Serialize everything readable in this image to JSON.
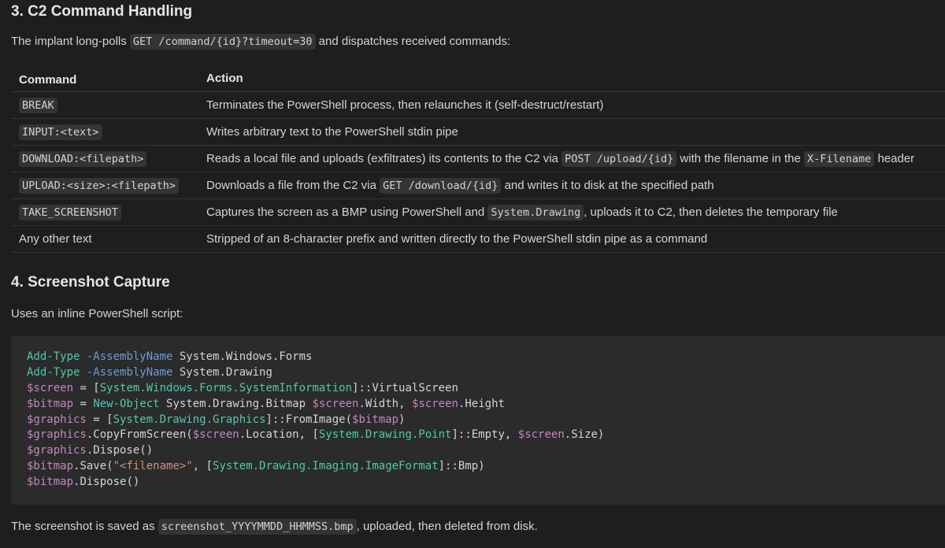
{
  "section3": {
    "heading": "3. C2 Command Handling",
    "intro_before": "The implant long-polls ",
    "intro_code": "GET /command/{id}?timeout=30",
    "intro_after": " and dispatches received commands:"
  },
  "table": {
    "headers": [
      "Command",
      "Action"
    ],
    "rows": [
      {
        "command": "BREAK",
        "command_is_code": true,
        "action_parts": [
          {
            "t": "Terminates the PowerShell process, then relaunches it (self-destruct/restart)"
          }
        ]
      },
      {
        "command": "INPUT:<text>",
        "command_is_code": true,
        "action_parts": [
          {
            "t": "Writes arbitrary text to the PowerShell stdin pipe"
          }
        ]
      },
      {
        "command": "DOWNLOAD:<filepath>",
        "command_is_code": true,
        "action_parts": [
          {
            "t": "Reads a local file and uploads (exfiltrates) its contents to the C2 via "
          },
          {
            "c": "POST /upload/{id}"
          },
          {
            "t": " with the filename in the "
          },
          {
            "c": "X-Filename"
          },
          {
            "t": " header"
          }
        ]
      },
      {
        "command": "UPLOAD:<size>:<filepath>",
        "command_is_code": true,
        "action_parts": [
          {
            "t": "Downloads a file from the C2 via "
          },
          {
            "c": "GET /download/{id}"
          },
          {
            "t": " and writes it to disk at the specified path"
          }
        ]
      },
      {
        "command": "TAKE_SCREENSHOT",
        "command_is_code": true,
        "action_parts": [
          {
            "t": "Captures the screen as a BMP using PowerShell and "
          },
          {
            "c": "System.Drawing"
          },
          {
            "t": ", uploads it to C2, then deletes the temporary file"
          }
        ]
      },
      {
        "command": "Any other text",
        "command_is_code": false,
        "action_parts": [
          {
            "t": "Stripped of an 8-character prefix and written directly to the PowerShell stdin pipe as a command"
          }
        ]
      }
    ]
  },
  "section4": {
    "heading": "4. Screenshot Capture",
    "intro": "Uses an inline PowerShell script:"
  },
  "code_lines": [
    [
      {
        "k": "kw",
        "t": "Add-Type"
      },
      {
        "k": "plain",
        "t": " "
      },
      {
        "k": "param",
        "t": "-AssemblyName"
      },
      {
        "k": "plain",
        "t": " System.Windows.Forms"
      }
    ],
    [
      {
        "k": "kw",
        "t": "Add-Type"
      },
      {
        "k": "plain",
        "t": " "
      },
      {
        "k": "param",
        "t": "-AssemblyName"
      },
      {
        "k": "plain",
        "t": " System.Drawing"
      }
    ],
    [
      {
        "k": "var",
        "t": "$screen"
      },
      {
        "k": "plain",
        "t": " = ["
      },
      {
        "k": "type",
        "t": "System.Windows.Forms.SystemInformation"
      },
      {
        "k": "plain",
        "t": "]::VirtualScreen"
      }
    ],
    [
      {
        "k": "var",
        "t": "$bitmap"
      },
      {
        "k": "plain",
        "t": " = "
      },
      {
        "k": "kw",
        "t": "New-Object"
      },
      {
        "k": "plain",
        "t": " System.Drawing.Bitmap "
      },
      {
        "k": "var",
        "t": "$screen"
      },
      {
        "k": "plain",
        "t": ".Width, "
      },
      {
        "k": "var",
        "t": "$screen"
      },
      {
        "k": "plain",
        "t": ".Height"
      }
    ],
    [
      {
        "k": "var",
        "t": "$graphics"
      },
      {
        "k": "plain",
        "t": " = ["
      },
      {
        "k": "type",
        "t": "System.Drawing.Graphics"
      },
      {
        "k": "plain",
        "t": "]::FromImage("
      },
      {
        "k": "var",
        "t": "$bitmap"
      },
      {
        "k": "plain",
        "t": ")"
      }
    ],
    [
      {
        "k": "var",
        "t": "$graphics"
      },
      {
        "k": "plain",
        "t": ".CopyFromScreen("
      },
      {
        "k": "var",
        "t": "$screen"
      },
      {
        "k": "plain",
        "t": ".Location, ["
      },
      {
        "k": "type",
        "t": "System.Drawing.Point"
      },
      {
        "k": "plain",
        "t": "]::Empty, "
      },
      {
        "k": "var",
        "t": "$screen"
      },
      {
        "k": "plain",
        "t": ".Size)"
      }
    ],
    [
      {
        "k": "var",
        "t": "$graphics"
      },
      {
        "k": "plain",
        "t": ".Dispose()"
      }
    ],
    [
      {
        "k": "var",
        "t": "$bitmap"
      },
      {
        "k": "plain",
        "t": ".Save("
      },
      {
        "k": "str",
        "t": "\"<filename>\""
      },
      {
        "k": "plain",
        "t": ", ["
      },
      {
        "k": "type",
        "t": "System.Drawing.Imaging.ImageFormat"
      },
      {
        "k": "plain",
        "t": "]::Bmp)"
      }
    ],
    [
      {
        "k": "var",
        "t": "$bitmap"
      },
      {
        "k": "plain",
        "t": ".Dispose()"
      }
    ]
  ],
  "footer": {
    "before": "The screenshot is saved as ",
    "code": "screenshot_YYYYMMDD_HHMMSS.bmp",
    "after": ", uploaded, then deleted from disk."
  }
}
